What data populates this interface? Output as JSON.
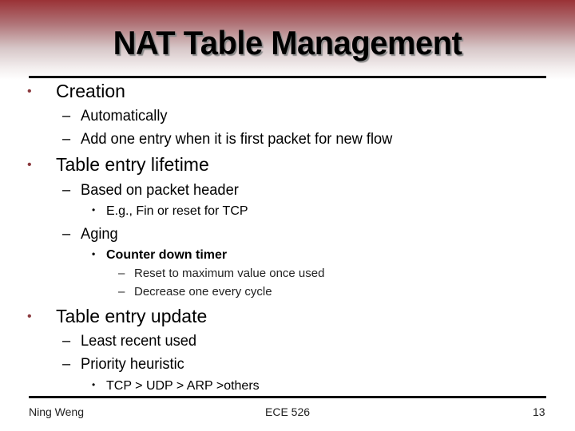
{
  "slide": {
    "title": "NAT Table Management",
    "bullets": [
      {
        "level": 1,
        "marker": "•",
        "text": "Creation"
      },
      {
        "level": 2,
        "marker": "–",
        "text": "Automatically"
      },
      {
        "level": 2,
        "marker": "–",
        "text": "Add one entry when it is first packet for new flow"
      },
      {
        "level": 1,
        "marker": "•",
        "text": "Table entry lifetime"
      },
      {
        "level": 2,
        "marker": "–",
        "text": "Based on packet header"
      },
      {
        "level": 3,
        "marker": "•",
        "text": "E.g., Fin or reset for TCP"
      },
      {
        "level": 2,
        "marker": "–",
        "text": "Aging"
      },
      {
        "level": 3,
        "marker": "•",
        "text": "Counter down timer"
      },
      {
        "level": 4,
        "marker": "–",
        "text": "Reset to maximum value once used"
      },
      {
        "level": 4,
        "marker": "–",
        "text": "Decrease one every cycle"
      },
      {
        "level": 1,
        "marker": "•",
        "text": "Table entry update"
      },
      {
        "level": 2,
        "marker": "–",
        "text": "Least recent used"
      },
      {
        "level": 2,
        "marker": "–",
        "text": "Priority heuristic"
      },
      {
        "level": 3,
        "marker": "•",
        "text": "TCP > UDP > ARP >others"
      }
    ]
  },
  "footer": {
    "author": "Ning Weng",
    "course": "ECE 526",
    "page": "13"
  },
  "colors": {
    "header_gradient_top": "#9a3236",
    "bullet_accent": "#8b3a3e"
  }
}
